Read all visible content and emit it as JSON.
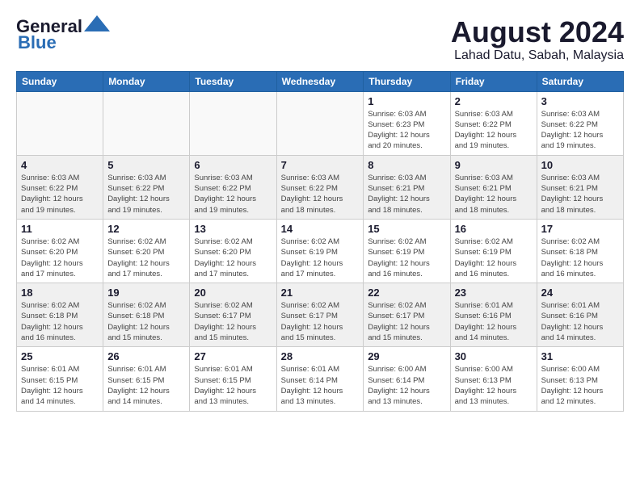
{
  "header": {
    "logo_general": "General",
    "logo_blue": "Blue",
    "month_year": "August 2024",
    "location": "Lahad Datu, Sabah, Malaysia"
  },
  "calendar": {
    "days_of_week": [
      "Sunday",
      "Monday",
      "Tuesday",
      "Wednesday",
      "Thursday",
      "Friday",
      "Saturday"
    ],
    "weeks": [
      [
        {
          "day": "",
          "info": ""
        },
        {
          "day": "",
          "info": ""
        },
        {
          "day": "",
          "info": ""
        },
        {
          "day": "",
          "info": ""
        },
        {
          "day": "1",
          "info": "Sunrise: 6:03 AM\nSunset: 6:23 PM\nDaylight: 12 hours\nand 20 minutes."
        },
        {
          "day": "2",
          "info": "Sunrise: 6:03 AM\nSunset: 6:22 PM\nDaylight: 12 hours\nand 19 minutes."
        },
        {
          "day": "3",
          "info": "Sunrise: 6:03 AM\nSunset: 6:22 PM\nDaylight: 12 hours\nand 19 minutes."
        }
      ],
      [
        {
          "day": "4",
          "info": "Sunrise: 6:03 AM\nSunset: 6:22 PM\nDaylight: 12 hours\nand 19 minutes."
        },
        {
          "day": "5",
          "info": "Sunrise: 6:03 AM\nSunset: 6:22 PM\nDaylight: 12 hours\nand 19 minutes."
        },
        {
          "day": "6",
          "info": "Sunrise: 6:03 AM\nSunset: 6:22 PM\nDaylight: 12 hours\nand 19 minutes."
        },
        {
          "day": "7",
          "info": "Sunrise: 6:03 AM\nSunset: 6:22 PM\nDaylight: 12 hours\nand 18 minutes."
        },
        {
          "day": "8",
          "info": "Sunrise: 6:03 AM\nSunset: 6:21 PM\nDaylight: 12 hours\nand 18 minutes."
        },
        {
          "day": "9",
          "info": "Sunrise: 6:03 AM\nSunset: 6:21 PM\nDaylight: 12 hours\nand 18 minutes."
        },
        {
          "day": "10",
          "info": "Sunrise: 6:03 AM\nSunset: 6:21 PM\nDaylight: 12 hours\nand 18 minutes."
        }
      ],
      [
        {
          "day": "11",
          "info": "Sunrise: 6:02 AM\nSunset: 6:20 PM\nDaylight: 12 hours\nand 17 minutes."
        },
        {
          "day": "12",
          "info": "Sunrise: 6:02 AM\nSunset: 6:20 PM\nDaylight: 12 hours\nand 17 minutes."
        },
        {
          "day": "13",
          "info": "Sunrise: 6:02 AM\nSunset: 6:20 PM\nDaylight: 12 hours\nand 17 minutes."
        },
        {
          "day": "14",
          "info": "Sunrise: 6:02 AM\nSunset: 6:19 PM\nDaylight: 12 hours\nand 17 minutes."
        },
        {
          "day": "15",
          "info": "Sunrise: 6:02 AM\nSunset: 6:19 PM\nDaylight: 12 hours\nand 16 minutes."
        },
        {
          "day": "16",
          "info": "Sunrise: 6:02 AM\nSunset: 6:19 PM\nDaylight: 12 hours\nand 16 minutes."
        },
        {
          "day": "17",
          "info": "Sunrise: 6:02 AM\nSunset: 6:18 PM\nDaylight: 12 hours\nand 16 minutes."
        }
      ],
      [
        {
          "day": "18",
          "info": "Sunrise: 6:02 AM\nSunset: 6:18 PM\nDaylight: 12 hours\nand 16 minutes."
        },
        {
          "day": "19",
          "info": "Sunrise: 6:02 AM\nSunset: 6:18 PM\nDaylight: 12 hours\nand 15 minutes."
        },
        {
          "day": "20",
          "info": "Sunrise: 6:02 AM\nSunset: 6:17 PM\nDaylight: 12 hours\nand 15 minutes."
        },
        {
          "day": "21",
          "info": "Sunrise: 6:02 AM\nSunset: 6:17 PM\nDaylight: 12 hours\nand 15 minutes."
        },
        {
          "day": "22",
          "info": "Sunrise: 6:02 AM\nSunset: 6:17 PM\nDaylight: 12 hours\nand 15 minutes."
        },
        {
          "day": "23",
          "info": "Sunrise: 6:01 AM\nSunset: 6:16 PM\nDaylight: 12 hours\nand 14 minutes."
        },
        {
          "day": "24",
          "info": "Sunrise: 6:01 AM\nSunset: 6:16 PM\nDaylight: 12 hours\nand 14 minutes."
        }
      ],
      [
        {
          "day": "25",
          "info": "Sunrise: 6:01 AM\nSunset: 6:15 PM\nDaylight: 12 hours\nand 14 minutes."
        },
        {
          "day": "26",
          "info": "Sunrise: 6:01 AM\nSunset: 6:15 PM\nDaylight: 12 hours\nand 14 minutes."
        },
        {
          "day": "27",
          "info": "Sunrise: 6:01 AM\nSunset: 6:15 PM\nDaylight: 12 hours\nand 13 minutes."
        },
        {
          "day": "28",
          "info": "Sunrise: 6:01 AM\nSunset: 6:14 PM\nDaylight: 12 hours\nand 13 minutes."
        },
        {
          "day": "29",
          "info": "Sunrise: 6:00 AM\nSunset: 6:14 PM\nDaylight: 12 hours\nand 13 minutes."
        },
        {
          "day": "30",
          "info": "Sunrise: 6:00 AM\nSunset: 6:13 PM\nDaylight: 12 hours\nand 13 minutes."
        },
        {
          "day": "31",
          "info": "Sunrise: 6:00 AM\nSunset: 6:13 PM\nDaylight: 12 hours\nand 12 minutes."
        }
      ]
    ]
  }
}
